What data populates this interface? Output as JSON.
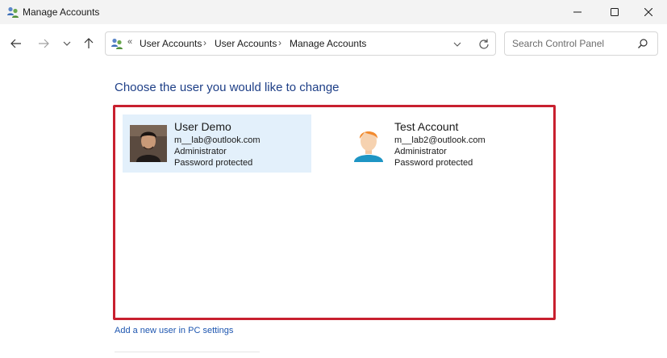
{
  "window": {
    "title": "Manage Accounts",
    "icon": "user-accounts-icon",
    "controls": [
      "minimize-icon",
      "maximize-icon",
      "close-icon"
    ]
  },
  "nav": {
    "back_icon": "arrow-left-icon",
    "forward_icon": "arrow-right-icon",
    "recent_icon": "chevron-down-icon",
    "up_icon": "arrow-up-icon"
  },
  "address": {
    "overflow": "«",
    "crumbs": [
      "User Accounts",
      "User Accounts",
      "Manage Accounts"
    ],
    "separator": "›"
  },
  "search": {
    "placeholder": "Search Control Panel"
  },
  "main": {
    "heading": "Choose the user you would like to change",
    "accounts": [
      {
        "name": "User Demo",
        "email": "m__lab@outlook.com",
        "role": "Administrator",
        "status": "Password protected",
        "selected": true
      },
      {
        "name": "Test Account",
        "email": "m__lab2@outlook.com",
        "role": "Administrator",
        "status": "Password protected",
        "selected": false
      }
    ],
    "add_user_link": "Add a new user in PC settings"
  },
  "colors": {
    "heading": "#1e3f87",
    "highlight_border": "#c8202f",
    "selected_bg": "#e3f0fb",
    "link": "#1e56b0"
  }
}
